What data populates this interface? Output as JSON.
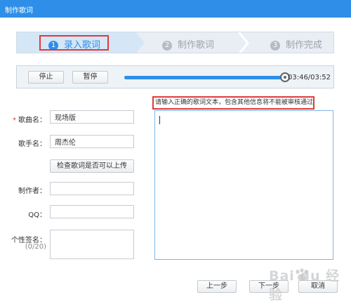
{
  "window": {
    "title": "制作歌词"
  },
  "steps": [
    {
      "num": "1",
      "label": "录入歌词",
      "active": true
    },
    {
      "num": "2",
      "label": "制作歌词",
      "active": false
    },
    {
      "num": "3",
      "label": "制作完成",
      "active": false
    }
  ],
  "player": {
    "stop_label": "停止",
    "pause_label": "暂停",
    "progress": 0.984,
    "time": "03:46/03:52"
  },
  "form": {
    "song": {
      "label": "歌曲名：",
      "required_mark": "*",
      "value": "现场版"
    },
    "singer": {
      "label": "歌手名：",
      "value": "周杰伦"
    },
    "check_label": "检查歌词是否可以上传",
    "maker": {
      "label": "制作者：",
      "value": ""
    },
    "qq": {
      "label": "QQ：",
      "value": ""
    },
    "signature": {
      "label": "个性签名：",
      "counter": "(0/20)",
      "value": ""
    }
  },
  "lyrics": {
    "notice": "请输入正确的歌词文本，包含其他信息将不能被审核通过！",
    "value": ""
  },
  "footer": {
    "prev_label": "上一步",
    "next_label": "下一步",
    "cancel_label": "取消"
  },
  "watermark": "Bai du 经验",
  "colors": {
    "accent": "#2e8ee8",
    "highlight": "#e03a3a"
  }
}
